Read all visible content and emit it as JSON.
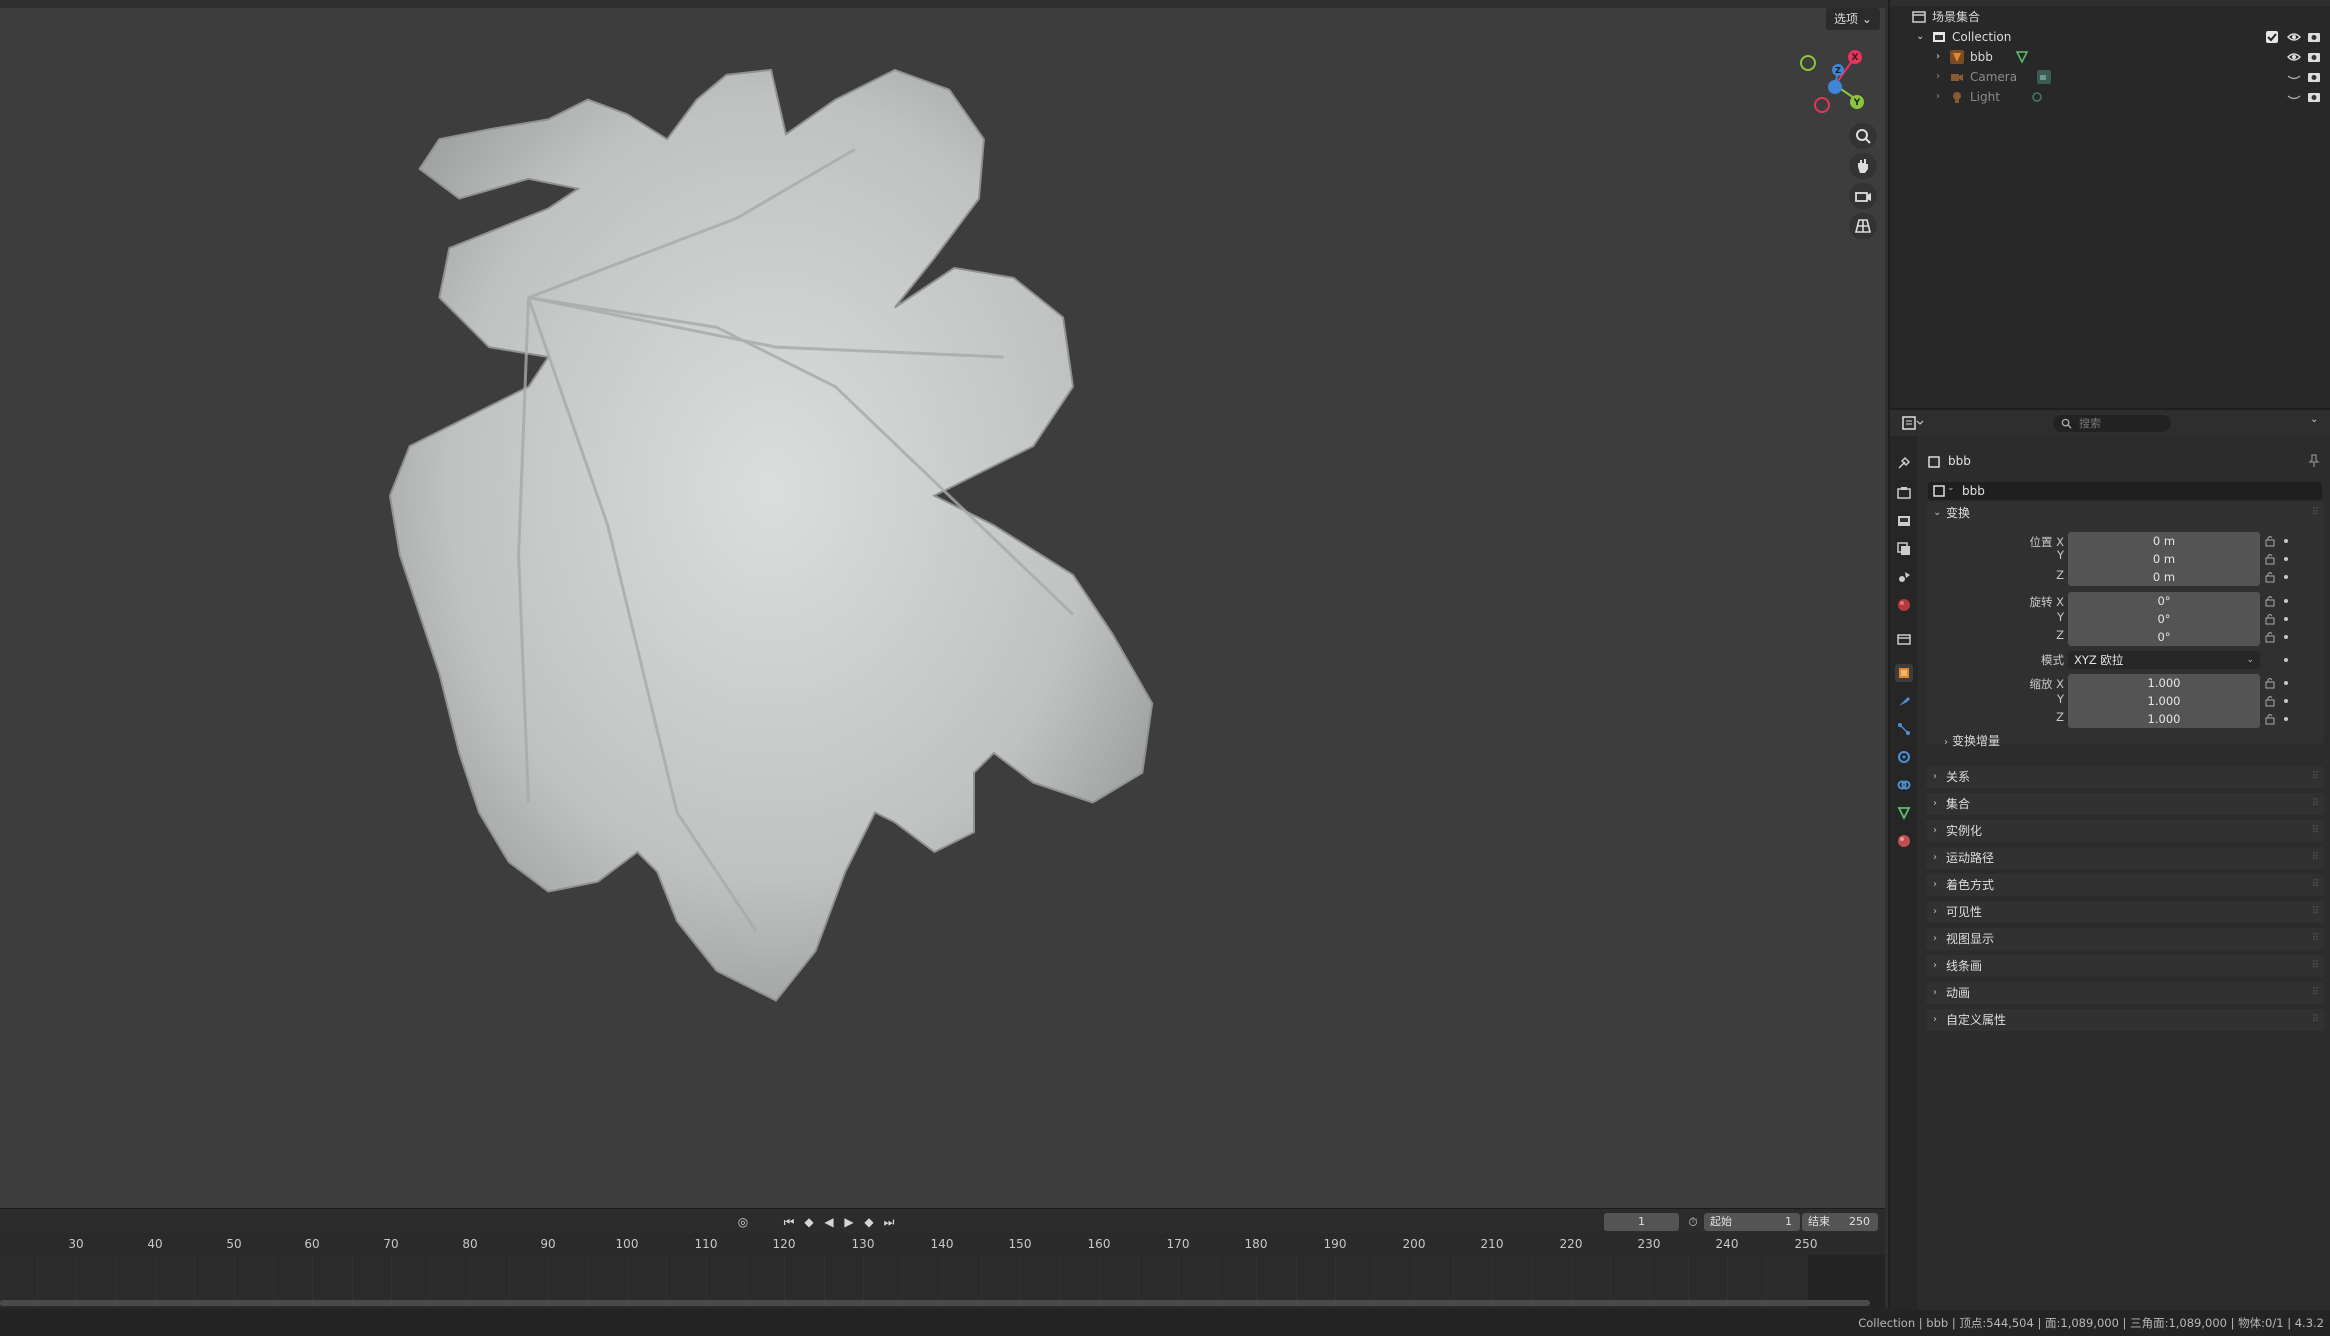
{
  "viewport": {
    "options_label": "选项",
    "gizmo": {
      "x": "X",
      "y": "Y",
      "z": "Z"
    }
  },
  "nav_icons": [
    "zoom-icon",
    "hand-pan-icon",
    "camera-icon",
    "grid-perspective-icon"
  ],
  "timeline": {
    "current_frame": "1",
    "start_label": "起始",
    "start_value": "1",
    "end_label": "结束",
    "end_value": "250",
    "ticks": [
      "30",
      "40",
      "50",
      "60",
      "70",
      "80",
      "90",
      "100",
      "110",
      "120",
      "130",
      "140",
      "150",
      "160",
      "170",
      "180",
      "190",
      "200",
      "210",
      "220",
      "230",
      "240",
      "250"
    ]
  },
  "status": {
    "text": "Collection | bbb | 顶点:544,504 | 面:1,089,000 | 三角面:1,089,000 | 物体:0/1 | 4.3.2"
  },
  "outliner": {
    "root": "场景集合",
    "collection": "Collection",
    "items": [
      {
        "name": "bbb",
        "active": true
      },
      {
        "name": "Camera",
        "active": false
      },
      {
        "name": "Light",
        "active": false
      }
    ]
  },
  "properties": {
    "search_placeholder": "搜索",
    "object_name": "bbb",
    "datablock_name": "bbb",
    "transform": {
      "header": "变换",
      "location_label": "位置 X",
      "rotation_label": "旋转 X",
      "mode_label": "模式",
      "scale_label": "缩放 X",
      "axis_y": "Y",
      "axis_z": "Z",
      "location": [
        "0 m",
        "0 m",
        "0 m"
      ],
      "rotation": [
        "0°",
        "0°",
        "0°"
      ],
      "mode": "XYZ 欧拉",
      "scale": [
        "1.000",
        "1.000",
        "1.000"
      ],
      "delta": "变换增量"
    },
    "panels": [
      "关系",
      "集合",
      "实例化",
      "运动路径",
      "着色方式",
      "可见性",
      "视图显示",
      "线条画",
      "动画",
      "自定义属性"
    ]
  },
  "colors": {
    "viewport_bg": "#3d3d3d",
    "axis_x": "#e8335a",
    "axis_y": "#8bc53f",
    "axis_z": "#3f86d6",
    "object_orange": "#e3872e",
    "mesh_green": "#5fbf6a"
  }
}
